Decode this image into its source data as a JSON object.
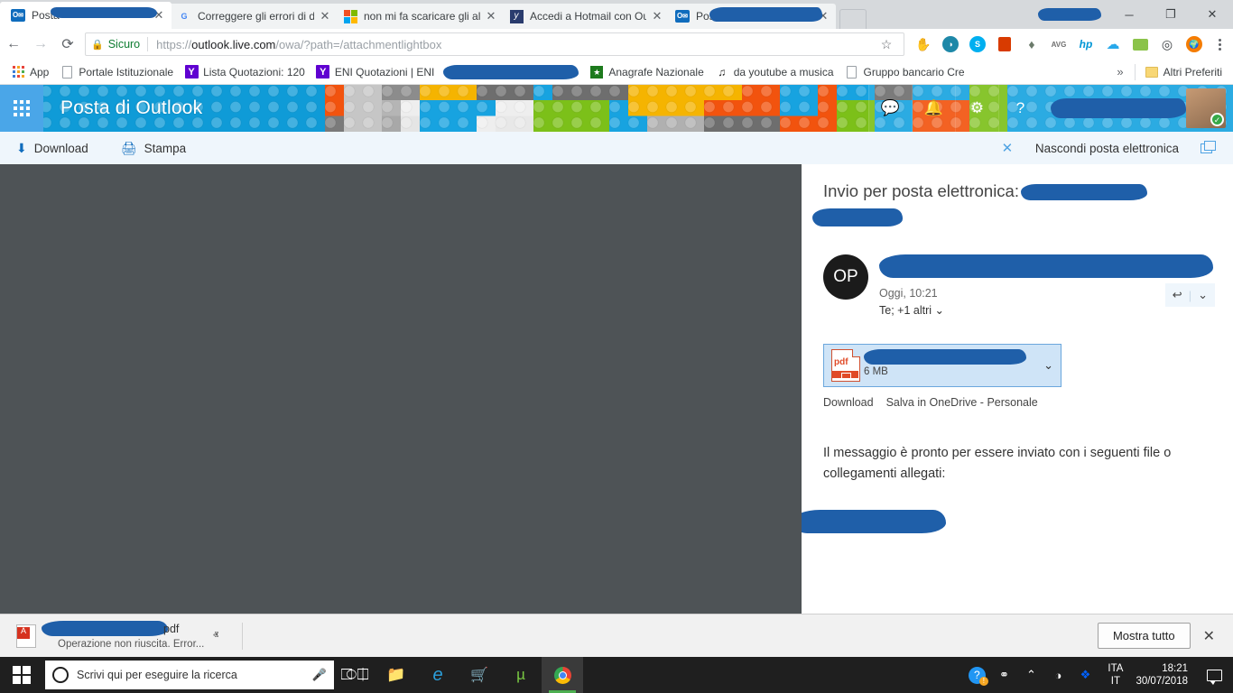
{
  "browser": {
    "tabs": [
      {
        "title": "Posta",
        "favicon": "outlook-icon",
        "active": true,
        "redacted": true
      },
      {
        "title": "Correggere gli errori di d",
        "favicon": "google-icon",
        "active": false,
        "redacted": false
      },
      {
        "title": "non mi fa scaricare gli all",
        "favicon": "microsoft-icon",
        "active": false,
        "redacted": false
      },
      {
        "title": "Accedi a Hotmail con Ou",
        "favicon": "hotmail-icon",
        "active": false,
        "redacted": false
      },
      {
        "title": "Posta -",
        "favicon": "outlook-icon",
        "active": false,
        "redacted": true
      }
    ],
    "tab_close_glyph": "✕",
    "window_controls": {
      "minimize": "─",
      "maximize": "❐",
      "close": "✕"
    },
    "nav": {
      "back": "←",
      "forward": "→",
      "reload": "⟳"
    },
    "omnibox": {
      "secure_label": "Sicuro",
      "lock_icon": "lock-icon",
      "url_scheme": "https://",
      "url_host": "outlook.live.com",
      "url_path": "/owa/?path=/attachmentlightbox",
      "star_icon": "☆"
    },
    "extensions": [
      {
        "name": "touch-vpn-icon",
        "glyph": "✋",
        "color": "#2196f3"
      },
      {
        "name": "adblock-icon",
        "glyph": "●",
        "color": "#1e88a8"
      },
      {
        "name": "skype-icon",
        "glyph": "S",
        "color": "#00aff0"
      },
      {
        "name": "office-icon",
        "glyph": "◗",
        "color": "#d83b01"
      },
      {
        "name": "evernote-icon",
        "glyph": "◆",
        "color": "#6b7b6b"
      },
      {
        "name": "avg-icon",
        "glyph": "AVG",
        "color": "#6f6f6f"
      },
      {
        "name": "hp-icon",
        "glyph": "hp",
        "color": "#0096d6"
      },
      {
        "name": "onedrive-icon",
        "glyph": "☁",
        "color": "#28a8ea"
      },
      {
        "name": "note-icon",
        "glyph": "▬",
        "color": "#8bc34a"
      },
      {
        "name": "chrome-tool-icon",
        "glyph": "◎",
        "color": "#3c4043"
      },
      {
        "name": "globe-icon",
        "glyph": "●",
        "color": "#f57c00"
      }
    ],
    "menu_icon": "three-dots-icon",
    "bookmarks": [
      {
        "label": "App",
        "icon": "apps-grid-icon"
      },
      {
        "label": "Portale Istituzionale",
        "icon": "page-icon"
      },
      {
        "label": "Lista Quotazioni: 120",
        "icon": "yahoo-icon"
      },
      {
        "label": "ENI Quotazioni | ENI",
        "icon": "yahoo-icon"
      },
      {
        "label": "",
        "icon": "redacted-icon",
        "redacted": true
      },
      {
        "label": "Anagrafe Nazionale",
        "icon": "green-shield-icon"
      },
      {
        "label": "da youtube a musica",
        "icon": "music-icon"
      },
      {
        "label": "Gruppo bancario Cre",
        "icon": "page-icon"
      }
    ],
    "bookmarks_overflow": "»",
    "other_bookmarks": "Altri Preferiti"
  },
  "outlook_header": {
    "waffle_icon": "app-launcher-icon",
    "title": "Posta di Outlook",
    "icons": [
      {
        "name": "skype-chat-icon",
        "glyph": "💬"
      },
      {
        "name": "notifications-bell-icon",
        "glyph": "🔔"
      },
      {
        "name": "settings-gear-icon",
        "glyph": "⚙"
      },
      {
        "name": "help-icon",
        "glyph": "?"
      }
    ],
    "user_name_redacted": true,
    "avatar_status": "online-check-icon"
  },
  "lightbox_toolbar": {
    "download_label": "Download",
    "download_icon": "download-arrow-icon",
    "print_label": "Stampa",
    "print_icon": "printer-icon",
    "close_icon": "close-x-icon",
    "hide_mail_label": "Nascondi posta elettronica",
    "popout_icon": "popout-window-icon"
  },
  "mail": {
    "subject_prefix": "Invio per posta elettronica:",
    "subject_redacted": true,
    "avatar_initials": "OP",
    "sender_redacted": true,
    "date": "Oggi, 10:21",
    "recipients": "Te; +1 altri",
    "recipients_chevron": "⌄",
    "reply_icon": "reply-arrow-icon",
    "reply_glyph": "↩",
    "more_actions_glyph": "⌄",
    "attachment": {
      "file_type_icon": "pdf-file-icon",
      "file_type_label": "pdf",
      "name_redacted": true,
      "size": "6 MB",
      "chevron": "⌄",
      "actions": [
        "Download",
        "Salva in OneDrive - Personale"
      ]
    },
    "body_line1": "Il messaggio è pronto per essere inviato con i seguenti file o",
    "body_line2": "collegamenti allegati:",
    "signature_redacted": true
  },
  "download_bar": {
    "file_icon": "pdf-file-icon",
    "file_name_redacted": true,
    "file_extension": "pdf",
    "status": "Operazione non riuscita. Error...",
    "chevron": "ⱏ",
    "show_all_label": "Mostra tutto",
    "close_icon": "close-x-icon"
  },
  "taskbar": {
    "start_icon": "windows-start-icon",
    "search_placeholder": "Scrivi qui per eseguire la ricerca",
    "cortana_icon": "cortana-circle-icon",
    "mic_icon": "microphone-icon",
    "pinned": [
      {
        "name": "task-view-icon",
        "glyph": "⌸"
      },
      {
        "name": "file-explorer-icon",
        "glyph": "📁"
      },
      {
        "name": "edge-icon",
        "glyph": "e"
      },
      {
        "name": "microsoft-store-icon",
        "glyph": "🛍"
      },
      {
        "name": "utorrent-icon",
        "glyph": "µ"
      },
      {
        "name": "chrome-icon",
        "glyph": "◉",
        "active": true
      }
    ],
    "tray": [
      {
        "name": "help-warning-icon",
        "glyph": "?"
      },
      {
        "name": "people-icon",
        "glyph": "⚹"
      },
      {
        "name": "show-hidden-icons-icon",
        "glyph": "ⱏ"
      },
      {
        "name": "wifi-icon",
        "glyph": "◔"
      },
      {
        "name": "dropbox-icon",
        "glyph": "❖"
      }
    ],
    "language_line1": "ITA",
    "language_line2": "IT",
    "time": "18:21",
    "date": "30/07/2018",
    "action_center_icon": "action-center-icon"
  },
  "colors": {
    "chrome_tabstrip": "#d6d9dc",
    "outlook_blue": "#0f9bd7",
    "lightbox_bar": "#eff6fc",
    "viewer_background": "#4e5356",
    "redaction_blue": "#1f5fa9",
    "accent_link": "#0f6cbd"
  }
}
